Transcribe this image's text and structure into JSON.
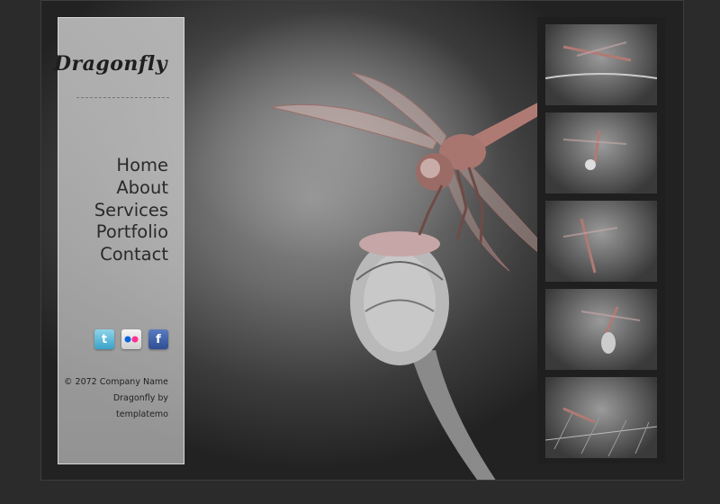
{
  "site": {
    "logo": "Dragonfly",
    "nav": [
      {
        "label": "Home"
      },
      {
        "label": "About"
      },
      {
        "label": "Services"
      },
      {
        "label": "Portfolio"
      },
      {
        "label": "Contact"
      }
    ],
    "social": [
      {
        "name": "twitter-icon",
        "glyph": "t"
      },
      {
        "name": "flickr-icon",
        "glyph": "••"
      },
      {
        "name": "facebook-icon",
        "glyph": "f"
      }
    ],
    "footer": {
      "copyright": "© 2072 Company Name",
      "credit_line1": "Dragonfly by",
      "credit_line2": "templatemo"
    }
  },
  "gallery": {
    "thumbnails": [
      {
        "name": "thumbnail-1"
      },
      {
        "name": "thumbnail-2"
      },
      {
        "name": "thumbnail-3"
      },
      {
        "name": "thumbnail-4"
      },
      {
        "name": "thumbnail-5"
      }
    ]
  },
  "colors": {
    "background": "#2b2b2b",
    "sidebar": "#c8c8c8",
    "dragonfly": "#b07a74",
    "text": "#2a2a2a"
  }
}
